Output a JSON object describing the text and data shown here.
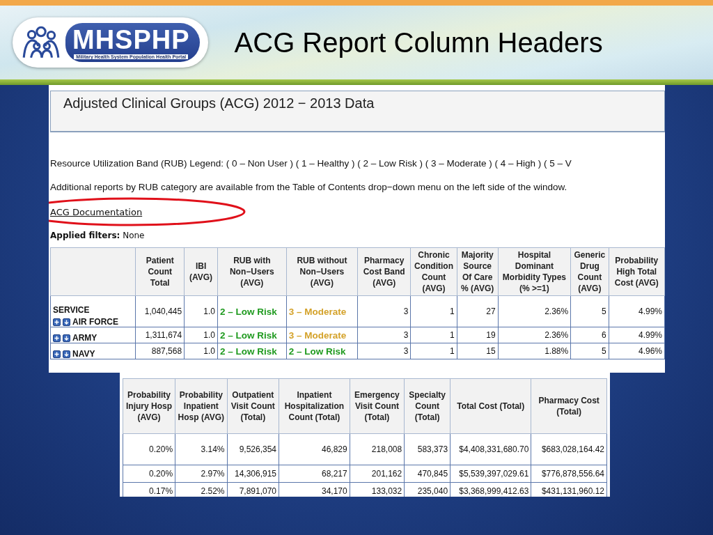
{
  "slide": {
    "title": "ACG Report Column Headers"
  },
  "logo": {
    "name": "MHSPHP",
    "tagline": "Military Health System Population Health Portal"
  },
  "report": {
    "heading": "Adjusted Clinical Groups (ACG)  2012 − 2013 Data",
    "legend": "Resource Utilization Band (RUB) Legend:  ( 0 – Non User )  ( 1 – Healthy )  ( 2 – Low Risk )  ( 3 – Moderate )  ( 4 – High )  ( 5 – V",
    "note": "Additional reports by RUB category are available from the Table of Contents drop−down menu on the left side of the window.",
    "link": "ACG Documentation",
    "filters": "**Applied filters:** None",
    "table": {
      "row_header": "SERVICE",
      "columns": [
        "Patient Count Total",
        "IBI (AVG)",
        "RUB with Non−Users (AVG)",
        "RUB without Non−Users (AVG)",
        "Pharmacy Cost Band (AVG)",
        "Chronic Condition Count (AVG)",
        "Majority Source Of Care % (AVG)",
        "Hospital Dominant Morbidity Types (% >=1)",
        "Generic Drug Count (AVG)",
        "Probability High Total Cost (AVG)"
      ],
      "rows": [
        {
          "label": "AIR FORCE",
          "cells": [
            {
              "text": "1,040,445"
            },
            {
              "text": "1.0"
            },
            {
              "text": "2 – Low Risk",
              "color": "#1f9a1f"
            },
            {
              "text": "3 – Moderate",
              "color": "#d4a22a"
            },
            {
              "text": "3"
            },
            {
              "text": "1"
            },
            {
              "text": "27"
            },
            {
              "text": "2.36%"
            },
            {
              "text": "5"
            },
            {
              "text": "4.99%"
            }
          ]
        },
        {
          "label": "ARMY",
          "cells": [
            {
              "text": "1,311,674"
            },
            {
              "text": "1.0"
            },
            {
              "text": "2 – Low Risk",
              "color": "#1f9a1f"
            },
            {
              "text": "3 – Moderate",
              "color": "#d4a22a"
            },
            {
              "text": "3"
            },
            {
              "text": "1"
            },
            {
              "text": "19"
            },
            {
              "text": "2.36%"
            },
            {
              "text": "6"
            },
            {
              "text": "4.99%"
            }
          ]
        },
        {
          "label": "NAVY",
          "cells": [
            {
              "text": "887,568"
            },
            {
              "text": "1.0"
            },
            {
              "text": "2 – Low Risk",
              "color": "#1f9a1f"
            },
            {
              "text": "2  – Low Risk",
              "color": "#1f9a1f"
            },
            {
              "text": "3"
            },
            {
              "text": "1"
            },
            {
              "text": "15"
            },
            {
              "text": "1.88%"
            },
            {
              "text": "5"
            },
            {
              "text": "4.96%"
            }
          ]
        }
      ]
    }
  },
  "table_continued": {
    "columns": [
      "Probability Injury Hosp (AVG)",
      "Probability Inpatient Hosp (AVG)",
      "Outpatient Visit Count (Total)",
      "Inpatient Hospitalization Count (Total)",
      "Emergency Visit Count (Total)",
      "Specialty Count (Total)",
      "Total Cost (Total)",
      "Pharmacy Cost (Total)"
    ],
    "rows": [
      [
        "0.20%",
        "3.14%",
        "9,526,354",
        "46,829",
        "218,008",
        "583,373",
        "$4,408,331,680.70",
        "$683,028,164.42"
      ],
      [
        "0.20%",
        "2.97%",
        "14,306,915",
        "68,217",
        "201,162",
        "470,845",
        "$5,539,397,029.61",
        "$776,878,556.64"
      ],
      [
        "0.17%",
        "2.52%",
        "7,891,070",
        "34,170",
        "133,032",
        "235,040",
        "$3,368,999,412.63",
        "$431,131,960.12"
      ]
    ]
  }
}
